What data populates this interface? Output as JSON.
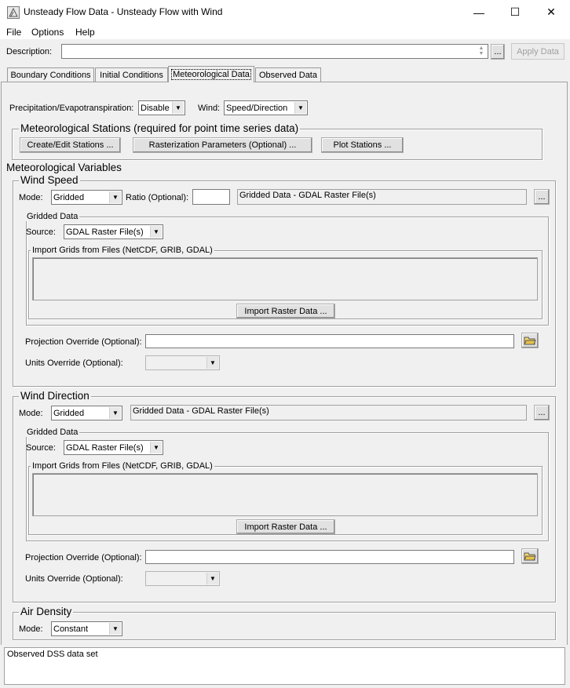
{
  "window": {
    "title": "Unsteady Flow Data - Unsteady Flow with Wind",
    "minimize": "—",
    "maximize": "☐",
    "close": "✕"
  },
  "menu": {
    "file": "File",
    "options": "Options",
    "help": "Help"
  },
  "description": {
    "label": "Description:",
    "value": "",
    "browse": "...",
    "apply": "Apply Data"
  },
  "tabs": [
    "Boundary Conditions",
    "Initial Conditions",
    "Meteorological Data",
    "Observed Data"
  ],
  "met": {
    "precip_label": "Precipitation/Evapotranspiration:",
    "precip_value": "Disable",
    "wind_label": "Wind:",
    "wind_value": "Speed/Direction",
    "stations_title": "Meteorological Stations (required for point time series data)",
    "create_edit": "Create/Edit Stations ...",
    "rasterization": "Rasterization Parameters (Optional) ...",
    "plot_stations": "Plot Stations ...",
    "variables_title": "Meteorological Variables"
  },
  "wind_speed": {
    "title": "Wind Speed",
    "mode_label": "Mode:",
    "mode_value": "Gridded",
    "ratio_label": "Ratio (Optional):",
    "ratio_value": "",
    "source_desc": "Gridded Data - GDAL Raster File(s)",
    "browse": "...",
    "gridded_title": "Gridded Data",
    "source_label": "Source:",
    "source_value": "GDAL Raster File(s)",
    "import_title": "Import Grids from Files (NetCDF, GRIB, GDAL)",
    "import_button": "Import Raster Data ...",
    "projection_label": "Projection Override (Optional):",
    "projection_value": "",
    "units_label": "Units Override (Optional):",
    "units_value": ""
  },
  "wind_direction": {
    "title": "Wind Direction",
    "mode_label": "Mode:",
    "mode_value": "Gridded",
    "source_desc": "Gridded Data - GDAL Raster File(s)",
    "browse": "...",
    "gridded_title": "Gridded Data",
    "source_label": "Source:",
    "source_value": "GDAL Raster File(s)",
    "import_title": "Import Grids from Files (NetCDF, GRIB, GDAL)",
    "import_button": "Import Raster Data ...",
    "projection_label": "Projection Override (Optional):",
    "projection_value": "",
    "units_label": "Units Override (Optional):",
    "units_value": ""
  },
  "air_density": {
    "title": "Air Density",
    "mode_label": "Mode:",
    "mode_value": "Constant"
  },
  "status": {
    "text": "Observed DSS data set"
  }
}
